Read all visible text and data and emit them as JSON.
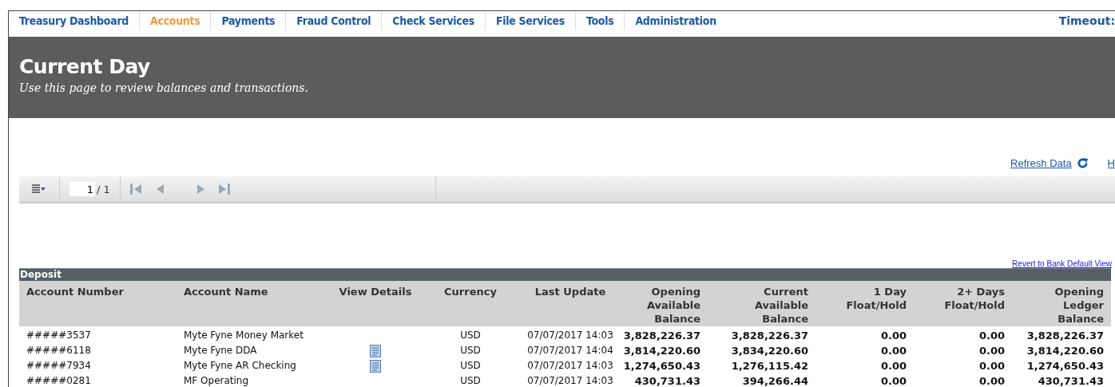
{
  "nav": {
    "items": [
      {
        "label": "Treasury Dashboard",
        "selected": false
      },
      {
        "label": "Accounts",
        "selected": true
      },
      {
        "label": "Payments",
        "selected": false
      },
      {
        "label": "Fraud Control",
        "selected": false
      },
      {
        "label": "Check Services",
        "selected": false
      },
      {
        "label": "File Services",
        "selected": false
      },
      {
        "label": "Tools",
        "selected": false
      },
      {
        "label": "Administration",
        "selected": false
      }
    ],
    "timeout_label": "Timeout:"
  },
  "header": {
    "title": "Current Day",
    "subtitle": "Use this page to review balances and transactions."
  },
  "links": {
    "refresh": "Refresh Data",
    "cut_link": "H"
  },
  "pager": {
    "page": "1",
    "total": "/ 1"
  },
  "revert_link": "Revert to Bank Default View",
  "table": {
    "group": "Deposit",
    "columns": [
      "Account Number",
      "Account Name",
      "View Details",
      "Currency",
      "Last Update",
      "Opening Available Balance",
      "Current Available Balance",
      "1 Day Float/Hold",
      "2+ Days Float/Hold",
      "Opening Ledger Balance"
    ],
    "rows": [
      {
        "account_number": "#####3537",
        "account_name": "Myte Fyne Money Market",
        "view_details": false,
        "currency": "USD",
        "last_update": "07/07/2017 14:03",
        "opening_available": "3,828,226.37",
        "current_available": "3,828,226.37",
        "float_1day": "0.00",
        "float_2plus": "0.00",
        "opening_ledger": "3,828,226.37"
      },
      {
        "account_number": "#####6118",
        "account_name": "Myte Fyne DDA",
        "view_details": true,
        "currency": "USD",
        "last_update": "07/07/2017 14:04",
        "opening_available": "3,814,220.60",
        "current_available": "3,834,220.60",
        "float_1day": "0.00",
        "float_2plus": "0.00",
        "opening_ledger": "3,814,220.60"
      },
      {
        "account_number": "#####7934",
        "account_name": "Myte Fyne AR Checking",
        "view_details": true,
        "currency": "USD",
        "last_update": "07/07/2017 14:03",
        "opening_available": "1,274,650.43",
        "current_available": "1,276,115.42",
        "float_1day": "0.00",
        "float_2plus": "0.00",
        "opening_ledger": "1,274,650.43"
      },
      {
        "account_number": "#####0281",
        "account_name": "MF Operating",
        "view_details": false,
        "currency": "USD",
        "last_update": "07/07/2017 14:03",
        "opening_available": "430,731.43",
        "current_available": "394,266.44",
        "float_1day": "0.00",
        "float_2plus": "0.00",
        "opening_ledger": "430,731.43"
      }
    ]
  }
}
